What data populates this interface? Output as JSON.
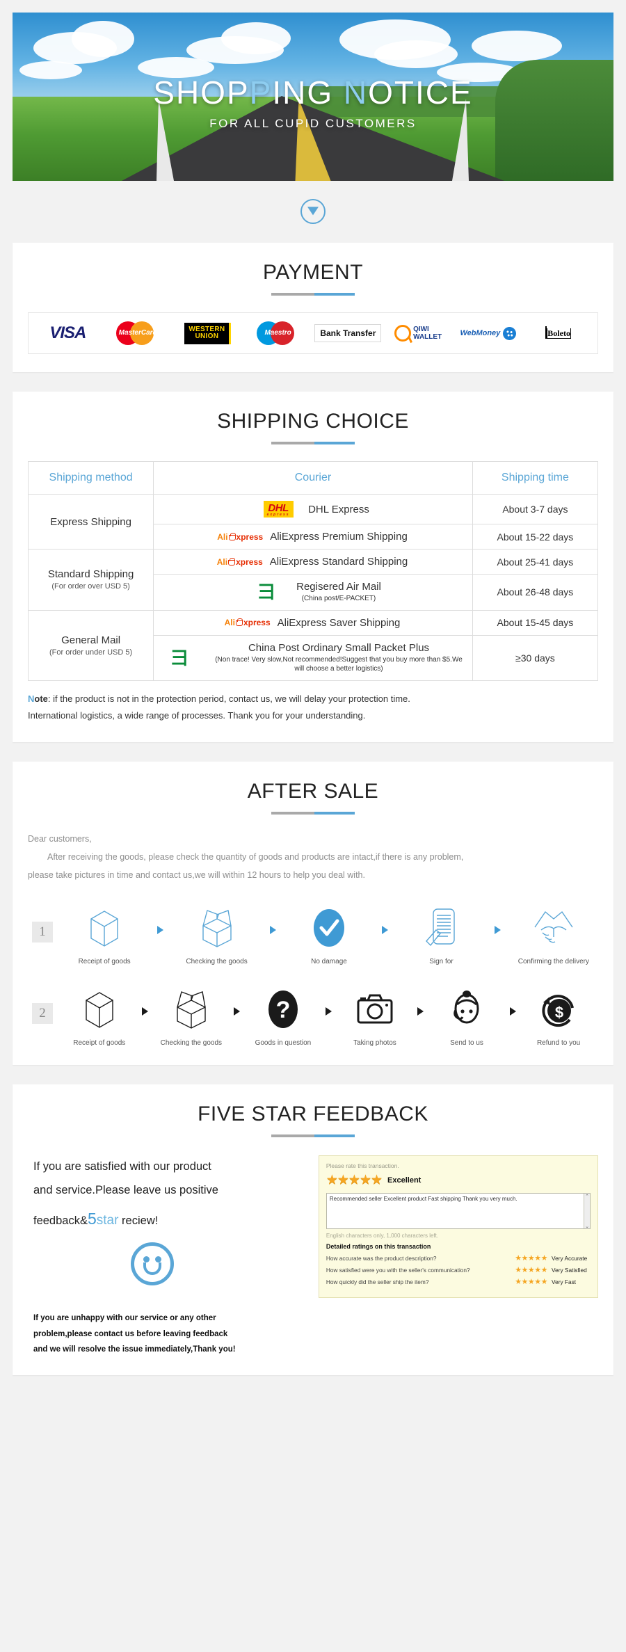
{
  "banner": {
    "title_part1": "SHOP",
    "title_hl1": "P",
    "title_part2": "ING ",
    "title_hl2": "N",
    "title_part3": "OTICE",
    "subtitle": "FOR ALL CUPID CUSTOMERS"
  },
  "scroll_arrow": {
    "icon": "chevron-down-icon"
  },
  "payment": {
    "title": "PAYMENT",
    "methods": [
      {
        "name": "visa",
        "label": "VISA"
      },
      {
        "name": "mastercard",
        "label": "MasterCard"
      },
      {
        "name": "western-union",
        "line1": "WESTERN",
        "line2": "UNION"
      },
      {
        "name": "maestro",
        "label": "Maestro"
      },
      {
        "name": "bank-transfer",
        "label": "Bank Transfer"
      },
      {
        "name": "qiwi-wallet",
        "line1": "QIWI",
        "line2": "WALLET"
      },
      {
        "name": "webmoney",
        "label": "WebMoney"
      },
      {
        "name": "boleto",
        "label": "Boleto"
      }
    ]
  },
  "shipping": {
    "title": "SHIPPING CHOICE",
    "headers": [
      "Shipping method",
      "Courier",
      "Shipping time"
    ],
    "groups": [
      {
        "method": "Express Shipping",
        "method_sub": "",
        "rows": [
          {
            "logo": "dhl",
            "courier": "DHL Express",
            "courier_sub": "",
            "time": "About 3-7 days"
          },
          {
            "logo": "aliexpress",
            "courier": "AliExpress Premium Shipping",
            "courier_sub": "",
            "time": "About 15-22 days"
          }
        ]
      },
      {
        "method": "Standard Shipping",
        "method_sub": "(For order over USD 5)",
        "rows": [
          {
            "logo": "aliexpress",
            "courier": "AliExpress Standard Shipping",
            "courier_sub": "",
            "time": "About 25-41 days"
          },
          {
            "logo": "china-post",
            "courier": "Regisered Air Mail",
            "courier_sub": "(China post/E-PACKET)",
            "time": "About 26-48 days"
          }
        ]
      },
      {
        "method": "General Mail",
        "method_sub": "(For order under USD 5)",
        "rows": [
          {
            "logo": "aliexpress",
            "courier": "AliExpress Saver Shipping",
            "courier_sub": "",
            "time": "About 15-45 days"
          },
          {
            "logo": "china-post",
            "courier": "China Post Ordinary Small Packet Plus",
            "courier_sub": "(Non trace!  Very slow,Not recommended!Suggest that you buy more than $5.We will choose a better logistics)",
            "time": "≥30 days"
          }
        ]
      }
    ],
    "note_prefix": "N",
    "note_bold": "ote",
    "note_line1": ": if the product is not in the protection period, contact us, we will delay your protection time.",
    "note_line2": "International logistics, a wide range of processes. Thank you for your understanding."
  },
  "aftersale": {
    "title": "AFTER SALE",
    "greeting": "Dear customers,",
    "para1": "After receiving the goods, please check the quantity of goods and products are intact,if there is any problem,",
    "para2": "please take pictures in time and contact us,we will within 12 hours to help you deal with.",
    "flow1": {
      "number": "1",
      "steps": [
        {
          "icon": "closed-box-icon",
          "label": "Receipt of goods"
        },
        {
          "icon": "open-box-icon",
          "label": "Checking the goods"
        },
        {
          "icon": "check-circle-icon",
          "label": "No damage"
        },
        {
          "icon": "signed-document-icon",
          "label": "Sign for"
        },
        {
          "icon": "handshake-icon",
          "label": "Confirming the delivery"
        }
      ]
    },
    "flow2": {
      "number": "2",
      "steps": [
        {
          "icon": "closed-box-icon",
          "label": "Receipt of goods"
        },
        {
          "icon": "open-box-icon",
          "label": "Checking the goods"
        },
        {
          "icon": "question-mark-icon",
          "label": "Goods in question"
        },
        {
          "icon": "camera-icon",
          "label": "Taking photos"
        },
        {
          "icon": "support-agent-icon",
          "label": "Send to us"
        },
        {
          "icon": "refund-dollar-icon",
          "label": "Refund to you"
        }
      ]
    }
  },
  "feedback": {
    "title": "FIVE STAR FEEDBACK",
    "head_line1": "If you are satisfied with our product",
    "head_line2": "and service.Please leave us positive",
    "head_line3_a": "feedback&",
    "head_line3_five": "5",
    "head_line3_star": "star",
    "head_line3_b": " reciew!",
    "foot_line1": "If you are unhappy with our service or any other",
    "foot_line2": "problem,please contact us before leaving feedback",
    "foot_line3": "and we will resolve the issue immediately,Thank you!",
    "widget": {
      "prompt": "Please rate this transaction.",
      "stars": "★★★★★",
      "rating_word": "Excellent",
      "review_text": "Recommended seller Excellent product Fast shipping Thank you very much.",
      "limit_text": "English characters only, 1,000 characters left.",
      "detail_title": "Detailed ratings on this transaction",
      "details": [
        {
          "question": "How accurate was the product description?",
          "stars": "★★★★★",
          "value": "Very Accurate"
        },
        {
          "question": "How satisfied were you with the seller's communication?",
          "stars": "★★★★★",
          "value": "Very Satisfied"
        },
        {
          "question": "How quickly did the seller ship the item?",
          "stars": "★★★★★",
          "value": "Very Fast"
        }
      ]
    }
  }
}
